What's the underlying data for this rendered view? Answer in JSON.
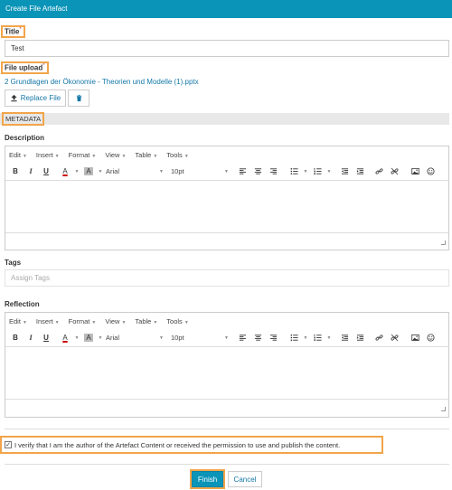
{
  "window": {
    "title": "Create File Artefact"
  },
  "title_field": {
    "label": "Title",
    "required_mark": "*",
    "value": "Test"
  },
  "file_upload": {
    "label": "File upload",
    "required_mark": "*",
    "file_name": "2 Grundlagen der Ökonomie - Theorien und Modelle (1).pptx",
    "replace_label": "Replace File"
  },
  "metadata": {
    "label": "METADATA"
  },
  "description": {
    "label": "Description"
  },
  "tags": {
    "label": "Tags",
    "placeholder": "Assign Tags"
  },
  "reflection": {
    "label": "Reflection"
  },
  "editor": {
    "menus": [
      "Edit",
      "Insert",
      "Format",
      "View",
      "Table",
      "Tools"
    ],
    "bold": "B",
    "italic": "I",
    "underline": "U",
    "text_color": "A",
    "bg_color": "A",
    "font_family": "Arial",
    "font_size": "10pt"
  },
  "consent": {
    "text": "I verify that I am the author of the Artefact Content or received the permission to use and publish the content.",
    "checked": true,
    "check_glyph": "✓"
  },
  "actions": {
    "finish": "Finish",
    "cancel": "Cancel"
  },
  "colors": {
    "header": "#0a94b8",
    "highlight": "#f2a54a",
    "link": "#1577a8"
  }
}
